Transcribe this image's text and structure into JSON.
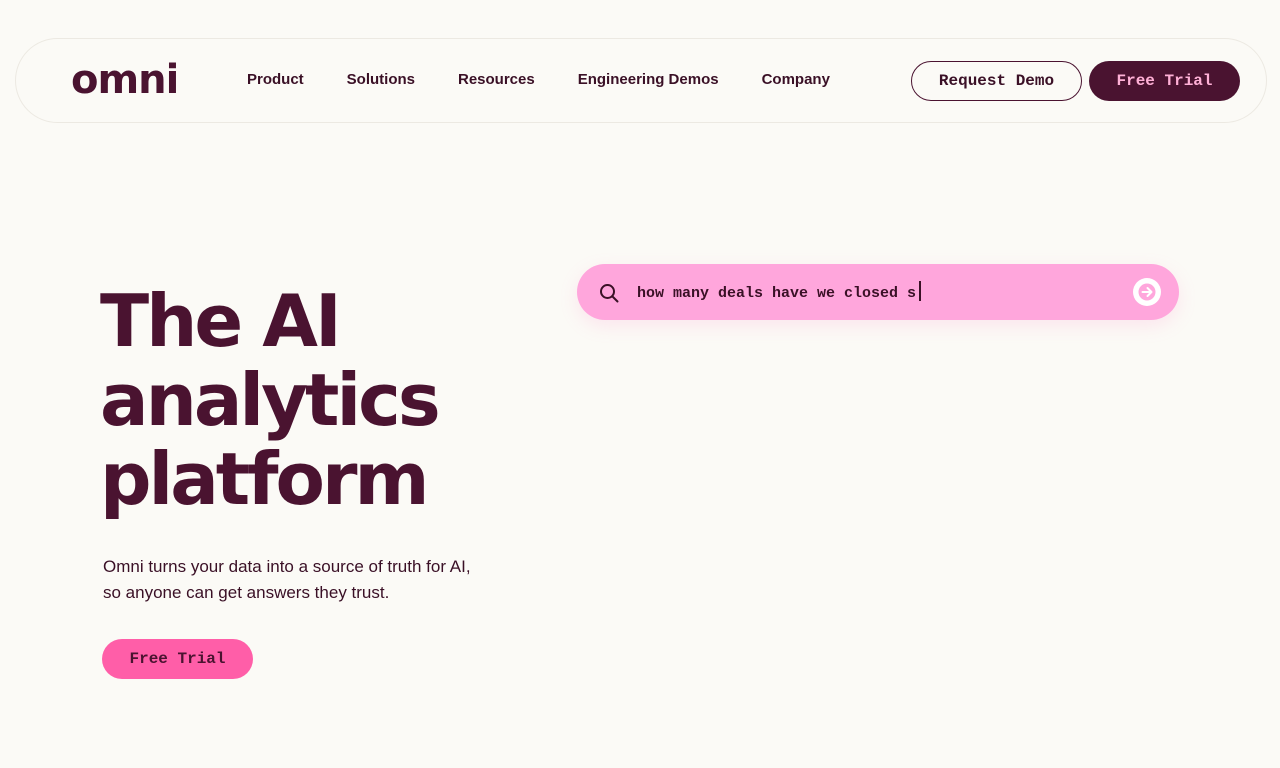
{
  "header": {
    "logo": "omni",
    "nav": [
      "Product",
      "Solutions",
      "Resources",
      "Engineering Demos",
      "Company"
    ],
    "request_demo": "Request Demo",
    "free_trial": "Free Trial"
  },
  "hero": {
    "title_lines": [
      "The AI",
      "analytics",
      "platform"
    ],
    "subtitle": "Omni turns your data into a source of truth for AI, so anyone can get answers they trust.",
    "cta": "Free Trial"
  },
  "search": {
    "query": "how many deals have we closed s",
    "icon": "search-icon",
    "submit_icon": "arrow-right-icon"
  },
  "colors": {
    "brand_dark": "#4a1330",
    "brand_pink": "#ff5ea8",
    "search_bg": "#ffa6dc",
    "page_bg": "#fbfaf6"
  }
}
